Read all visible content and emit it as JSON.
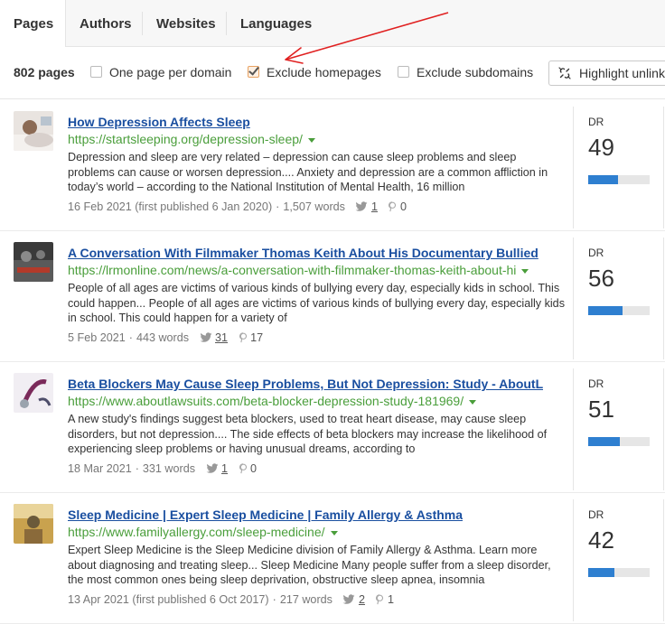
{
  "tabs": [
    {
      "label": "Pages",
      "active": true
    },
    {
      "label": "Authors",
      "active": false
    },
    {
      "label": "Websites",
      "active": false
    },
    {
      "label": "Languages",
      "active": false
    }
  ],
  "filters": {
    "count": "802 pages",
    "one_per_domain": {
      "label": "One page per domain",
      "checked": false
    },
    "exclude_homepages": {
      "label": "Exclude homepages",
      "checked": true
    },
    "exclude_subdomains": {
      "label": "Exclude subdomains",
      "checked": false
    },
    "highlight_button": "Highlight unlinked"
  },
  "colors": {
    "title": "#1a4fa0",
    "url": "#4a9e3b",
    "dr_bar": "#2e7fd0",
    "annotation_arrow": "#e02020"
  },
  "results": [
    {
      "title": "How Depression Affects Sleep",
      "url": "https://startsleeping.org/depression-sleep/",
      "description": "Depression and sleep are very related – depression can cause sleep problems and sleep problems can cause or worsen depression.... Anxiety and depression are a common affliction in today’s world – according to the National Institution of Mental Health, 16 million",
      "date": "16 Feb 2021 (first published 6 Jan 2020)",
      "words": "1,507 words",
      "tweets": "1",
      "pins": "0",
      "dr_label": "DR",
      "dr": 49
    },
    {
      "title": "A Conversation With Filmmaker Thomas Keith About His Documentary Bullied",
      "url": "https://lrmonline.com/news/a-conversation-with-filmmaker-thomas-keith-about-hi",
      "description": "People of all ages are victims of various kinds of bullying every day, especially kids in school. This could happen... People of all ages are victims of various kinds of bullying every day, especially kids in school. This could happen for a variety of",
      "date": "5 Feb 2021",
      "words": "443 words",
      "tweets": "31",
      "pins": "17",
      "dr_label": "DR",
      "dr": 56
    },
    {
      "title": "Beta Blockers May Cause Sleep Problems, But Not Depression: Study - AboutL",
      "url": "https://www.aboutlawsuits.com/beta-blocker-depression-study-181969/",
      "description": "A new study's findings suggest beta blockers, used to treat heart disease, may cause sleep disorders, but not depression.... The side effects of beta blockers may increase the likelihood of experiencing sleep problems or having unusual dreams, according to",
      "date": "18 Mar 2021",
      "words": "331 words",
      "tweets": "1",
      "pins": "0",
      "dr_label": "DR",
      "dr": 51
    },
    {
      "title": "Sleep Medicine | Expert Sleep Medicine | Family Allergy & Asthma",
      "url": "https://www.familyallergy.com/sleep-medicine/",
      "description": "Expert Sleep Medicine is the Sleep Medicine division of Family Allergy & Asthma. Learn more about diagnosing and treating sleep... Sleep Medicine Many people suffer from a sleep disorder, the most common ones being sleep deprivation, obstructive sleep apnea, insomnia",
      "date": "13 Apr 2021 (first published 6 Oct 2017)",
      "words": "217 words",
      "tweets": "2",
      "pins": "1",
      "dr_label": "DR",
      "dr": 42
    }
  ]
}
